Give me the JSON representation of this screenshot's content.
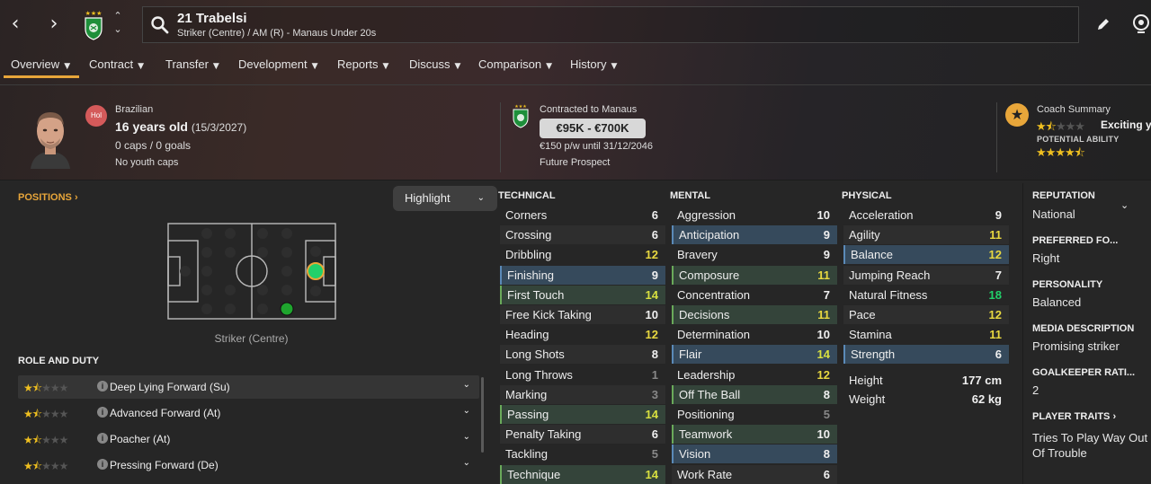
{
  "topbar": {
    "player_name": "21 Trabelsi",
    "player_subtitle": "Striker (Centre) / AM (R) - Manaus Under 20s"
  },
  "menu": {
    "items": [
      {
        "label": "Overview",
        "selected": true
      },
      {
        "label": "Contract"
      },
      {
        "label": "Transfer"
      },
      {
        "label": "Development"
      },
      {
        "label": "Reports"
      },
      {
        "label": "Discuss"
      },
      {
        "label": "Comparison"
      },
      {
        "label": "History"
      }
    ]
  },
  "header": {
    "status_badge": "Hol",
    "nationality": "Brazilian",
    "age": "16 years old",
    "dob": "(15/3/2027)",
    "caps": "0 caps / 0 goals",
    "youth_caps": "No youth caps",
    "contracted_to": "Contracted to Manaus",
    "value_range": "€95K - €700K",
    "wage": "€150 p/w until 31/12/2046",
    "prospect": "Future Prospect",
    "coach_summary_label": "Coach Summary",
    "current_ability_stars": 1.5,
    "coach_summary_text": "Exciting y",
    "potential_ability_label": "POTENTIAL ABILITY",
    "potential_ability_stars": 4.5
  },
  "positions": {
    "title": "POSITIONS",
    "highlight_label": "Highlight",
    "position_caption": "Striker (Centre)",
    "natural_position": "Striker (Centre)",
    "secondary_position": "AM (R)"
  },
  "roles": {
    "title": "ROLE AND DUTY",
    "items": [
      {
        "name": "Deep Lying Forward (Su)",
        "stars": 1.5
      },
      {
        "name": "Advanced Forward (At)",
        "stars": 1.5
      },
      {
        "name": "Poacher (At)",
        "stars": 1.5
      },
      {
        "name": "Pressing Forward (De)",
        "stars": 1.5
      }
    ]
  },
  "attributes": {
    "technical": {
      "title": "TECHNICAL",
      "items": [
        {
          "name": "Corners",
          "value": 6
        },
        {
          "name": "Crossing",
          "value": 6
        },
        {
          "name": "Dribbling",
          "value": 12
        },
        {
          "name": "Finishing",
          "value": 9,
          "hl": "blue"
        },
        {
          "name": "First Touch",
          "value": 14,
          "hl": "green"
        },
        {
          "name": "Free Kick Taking",
          "value": 10
        },
        {
          "name": "Heading",
          "value": 12
        },
        {
          "name": "Long Shots",
          "value": 8
        },
        {
          "name": "Long Throws",
          "value": 1
        },
        {
          "name": "Marking",
          "value": 3
        },
        {
          "name": "Passing",
          "value": 14,
          "hl": "green"
        },
        {
          "name": "Penalty Taking",
          "value": 6
        },
        {
          "name": "Tackling",
          "value": 5
        },
        {
          "name": "Technique",
          "value": 14,
          "hl": "green"
        }
      ]
    },
    "mental": {
      "title": "MENTAL",
      "items": [
        {
          "name": "Aggression",
          "value": 10
        },
        {
          "name": "Anticipation",
          "value": 9,
          "hl": "blue"
        },
        {
          "name": "Bravery",
          "value": 9
        },
        {
          "name": "Composure",
          "value": 11,
          "hl": "green"
        },
        {
          "name": "Concentration",
          "value": 7
        },
        {
          "name": "Decisions",
          "value": 11,
          "hl": "green"
        },
        {
          "name": "Determination",
          "value": 10
        },
        {
          "name": "Flair",
          "value": 14,
          "hl": "blue"
        },
        {
          "name": "Leadership",
          "value": 12
        },
        {
          "name": "Off The Ball",
          "value": 8,
          "hl": "green"
        },
        {
          "name": "Positioning",
          "value": 5
        },
        {
          "name": "Teamwork",
          "value": 10,
          "hl": "green"
        },
        {
          "name": "Vision",
          "value": 8,
          "hl": "blue"
        },
        {
          "name": "Work Rate",
          "value": 6
        }
      ]
    },
    "physical": {
      "title": "PHYSICAL",
      "items": [
        {
          "name": "Acceleration",
          "value": 9
        },
        {
          "name": "Agility",
          "value": 11
        },
        {
          "name": "Balance",
          "value": 12,
          "hl": "blue"
        },
        {
          "name": "Jumping Reach",
          "value": 7
        },
        {
          "name": "Natural Fitness",
          "value": 18
        },
        {
          "name": "Pace",
          "value": 12
        },
        {
          "name": "Stamina",
          "value": 11
        },
        {
          "name": "Strength",
          "value": 6,
          "hl": "blue"
        }
      ],
      "height_label": "Height",
      "height": "177 cm",
      "weight_label": "Weight",
      "weight": "62 kg"
    }
  },
  "side": {
    "reputation_label": "REPUTATION",
    "reputation": "National",
    "foot_label": "PREFERRED FO...",
    "foot": "Right",
    "personality_label": "PERSONALITY",
    "personality": "Balanced",
    "media_label": "MEDIA DESCRIPTION",
    "media": "Promising striker",
    "gk_label": "GOALKEEPER RATI...",
    "gk": "2",
    "traits_label": "PLAYER TRAITS",
    "trait_line1": "Tries To Play Way Out",
    "trait_line2": "Of Trouble"
  },
  "colors": {
    "accent": "#e8a63a",
    "natural_position": "#22d06a",
    "secondary_position": "#1fa52e",
    "blue_highlight": "#364a5c",
    "green_highlight": "#34443a"
  }
}
